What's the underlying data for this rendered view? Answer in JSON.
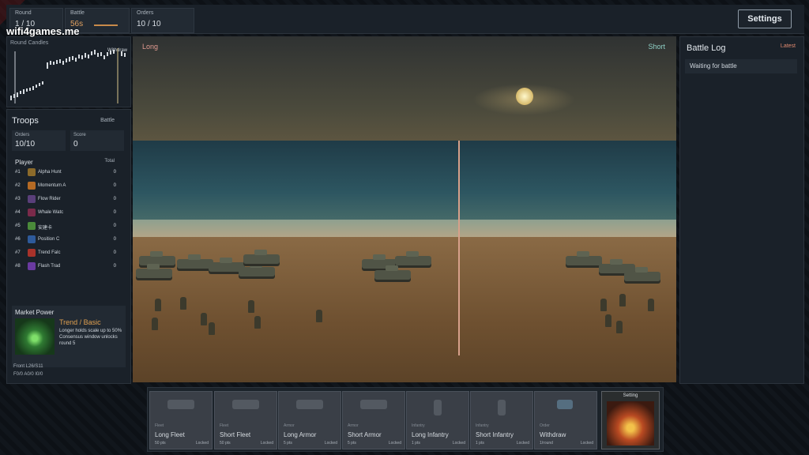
{
  "topbar": {
    "round_label": "Round",
    "round_value": "1 / 10",
    "battle_label": "Battle",
    "battle_value": "56s",
    "orders_label": "Orders",
    "orders_value": "10 / 10",
    "settings_label": "Settings"
  },
  "watermark": "wifi4games.me",
  "candles": {
    "title": "Round Candles",
    "withdraw_label": "Withdraw"
  },
  "troops": {
    "title": "Troops",
    "tag": "Battle",
    "orders_label": "Orders",
    "orders_value": "10/10",
    "score_label": "Score",
    "score_value": "0",
    "player_header": "Player",
    "total_header": "Total",
    "rows": [
      {
        "rank": "#1",
        "name": "Alpha Hunt",
        "total": "0",
        "color": "#8b6a2a"
      },
      {
        "rank": "#2",
        "name": "Momentum A",
        "total": "0",
        "color": "#b56a24"
      },
      {
        "rank": "#3",
        "name": "Flow Rider",
        "total": "0",
        "color": "#5a3f7a"
      },
      {
        "rank": "#4",
        "name": "Whale Watc",
        "total": "0",
        "color": "#7a2a4a"
      },
      {
        "rank": "#5",
        "name": "安建卡",
        "total": "0",
        "color": "#4a8a3a"
      },
      {
        "rank": "#6",
        "name": "Position C",
        "total": "0",
        "color": "#2e5a9a"
      },
      {
        "rank": "#7",
        "name": "Trend Falc",
        "total": "0",
        "color": "#a8322a"
      },
      {
        "rank": "#8",
        "name": "Flash Trad",
        "total": "0",
        "color": "#6a3aa0"
      }
    ],
    "market_power": {
      "title": "Market Power",
      "name": "Trend / Basic",
      "desc1": "Longer holds scale up to 50%",
      "desc2": "Consensus window unlocks round 5"
    },
    "front1": "Front L26/S11",
    "front2": "F0/0 A0/0 I0/0"
  },
  "battlefield": {
    "long_label": "Long",
    "short_label": "Short"
  },
  "battle_log": {
    "title": "Battle Log",
    "latest_label": "Latest",
    "entry": "Waiting for battle"
  },
  "cards": [
    {
      "type": "Fleet",
      "name": "Long Fleet",
      "pts": "50 pts",
      "status": "Locked"
    },
    {
      "type": "Fleet",
      "name": "Short Fleet",
      "pts": "50 pts",
      "status": "Locked"
    },
    {
      "type": "Armor",
      "name": "Long Armor",
      "pts": "5 pts",
      "status": "Locked"
    },
    {
      "type": "Armor",
      "name": "Short Armor",
      "pts": "5 pts",
      "status": "Locked"
    },
    {
      "type": "Infantry",
      "name": "Long Infantry",
      "pts": "1 pts",
      "status": "Locked"
    },
    {
      "type": "Infantry",
      "name": "Short Infantry",
      "pts": "1 pts",
      "status": "Locked"
    },
    {
      "type": "Order",
      "name": "Withdraw",
      "pts": "1/round",
      "status": "Locked"
    }
  ],
  "special_card": {
    "label": "Setting"
  },
  "colors": {
    "accent_orange": "#e0a060",
    "long": "#e19a90",
    "short": "#8fd0c6"
  }
}
